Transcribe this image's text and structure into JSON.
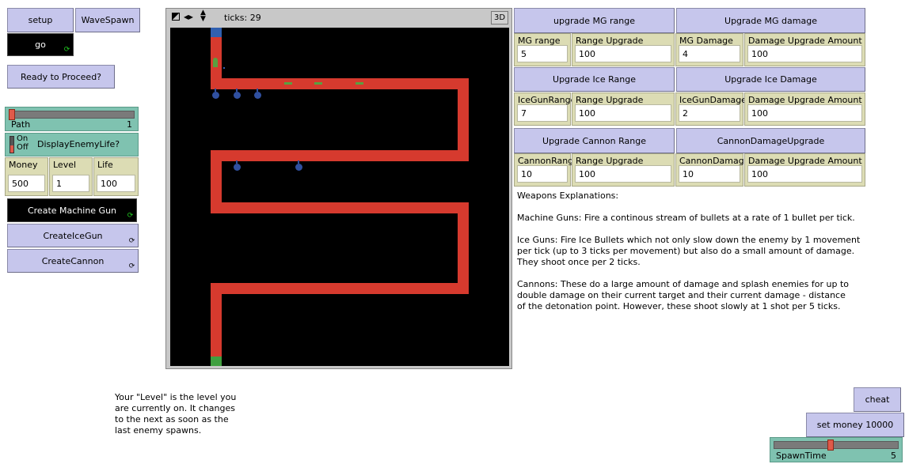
{
  "left_panel": {
    "setup_label": "setup",
    "wavespawn_label": "WaveSpawn",
    "go_label": "go",
    "ready_label": "Ready to Proceed?",
    "path_slider": {
      "label": "Path",
      "value": "1"
    },
    "switch": {
      "on": "On",
      "off": "Off",
      "label": "DisplayEnemyLife?"
    },
    "monitors": [
      {
        "label": "Money",
        "value": "500"
      },
      {
        "label": "Level",
        "value": "1"
      },
      {
        "label": "Life",
        "value": "100"
      }
    ],
    "create_mg_label": "Create Machine Gun",
    "create_ice_label": "CreateIceGun",
    "create_cannon_label": "CreateCannon"
  },
  "view": {
    "ticks_label": "ticks: 29",
    "three_d_label": "3D"
  },
  "upgrades": {
    "mg_range_btn": "upgrade MG range",
    "mg_damage_btn": "Upgrade MG damage",
    "mg_range": {
      "label": "MG range",
      "value": "5"
    },
    "mg_range_amt": {
      "label": "Range Upgrade Amount",
      "value": "100"
    },
    "mg_damage": {
      "label": "MG Damage",
      "value": "4"
    },
    "mg_damage_amt": {
      "label": "Damage Upgrade Amount",
      "value": "100"
    },
    "ice_range_btn": "Upgrade Ice Range",
    "ice_damage_btn": "Upgrade Ice Damage",
    "ice_range": {
      "label": "IceGunRange",
      "value": "7"
    },
    "ice_range_amt": {
      "label": "Range Upgrade Amount",
      "value": "100"
    },
    "ice_damage": {
      "label": "IceGunDamage",
      "value": "2"
    },
    "ice_damage_amt": {
      "label": "Damage Upgrade Amount",
      "value": "100"
    },
    "cannon_range_btn": "Upgrade Cannon Range",
    "cannon_damage_btn": "CannonDamageUpgrade",
    "cannon_range": {
      "label": "CannonRange",
      "value": "10"
    },
    "cannon_range_amt": {
      "label": "Range Upgrade Amount",
      "value": "100"
    },
    "cannon_damage": {
      "label": "CannonDamage",
      "value": "10"
    },
    "cannon_damage_amt": {
      "label": "Damage Upgrade Amount",
      "value": "100"
    }
  },
  "explanations": {
    "title": "Weapons Explanations:",
    "mg": "Machine Guns: Fire a continous stream of bullets at a rate of 1 bullet per tick.",
    "ice": "Ice Guns: Fire Ice Bullets which not only slow down the enemy by 1 movement per tick (up to 3 ticks per movement) but also do a small amount of damage. They shoot once per 2 ticks.",
    "cannon": "Cannons: These do a large amount of damage and splash enemies for up to double damage on their current target and their current damage - distance of the detonation point. However, these shoot slowly at 1 shot per 5 ticks."
  },
  "level_note": "Your \"Level\" is the level you are currently on. It changes to the next as soon as the last enemy spawns.",
  "bottom_right": {
    "cheat_label": "cheat",
    "set_money_label": "set money 10000",
    "spawntime": {
      "label": "SpawnTime",
      "value": "5",
      "fraction": 0.45
    }
  }
}
